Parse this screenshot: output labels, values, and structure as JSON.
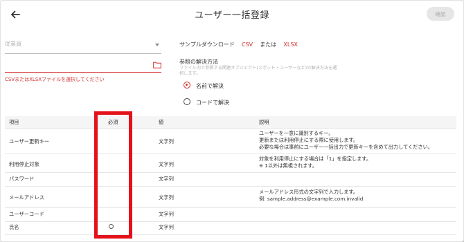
{
  "header": {
    "title": "ユーザー一括登録",
    "confirm_label": "確認"
  },
  "form": {
    "employee_placeholder": "従業員",
    "file_error": "CSVまたはXLSXファイルを選択してください"
  },
  "sample": {
    "label": "サンプルダウンロード",
    "csv": "CSV",
    "or": "または",
    "xlsx": "XLSX"
  },
  "reference": {
    "title": "参照の解決方法",
    "help": "ファイル内で参照する関連オブジェクト(スポット・ユーザーなど)の解決方法を選択します。",
    "options": [
      {
        "label": "名前で解決",
        "selected": true
      },
      {
        "label": "コードで解決",
        "selected": false
      }
    ]
  },
  "table": {
    "headers": {
      "item": "項目",
      "required": "必須",
      "value": "値",
      "description": "説明"
    },
    "rows": [
      {
        "item": "ユーザー更新キー",
        "required": "",
        "value": "文字列",
        "description": [
          "ユーザーを一意に識別するキー。",
          "更新または利用停止にする際に使用します。",
          "必要な場合は事前にユーザー一括出力で更新キーを含めて出力してください。"
        ]
      },
      {
        "item": "利用停止対象",
        "required": "",
        "value": "文字列",
        "description": [
          "対象を利用停止にする場合は「1」を指定します。",
          "※ 1以外は無視されます。"
        ]
      },
      {
        "item": "パスワード",
        "required": "",
        "value": "文字列",
        "description": []
      },
      {
        "item": "メールアドレス",
        "required": "",
        "value": "文字列",
        "description": [
          "メールアドレス形式の文字列で入力します。",
          "例: sample.address@example.com.invalid"
        ]
      },
      {
        "item": "ユーザーコード",
        "required": "",
        "value": "文字列",
        "description": []
      },
      {
        "item": "氏名",
        "required": "○",
        "value": "文字列",
        "description": []
      }
    ]
  },
  "colors": {
    "accent": "#d32f2f",
    "highlight": "#e4111a",
    "header_bg": "#f5f5f5"
  }
}
